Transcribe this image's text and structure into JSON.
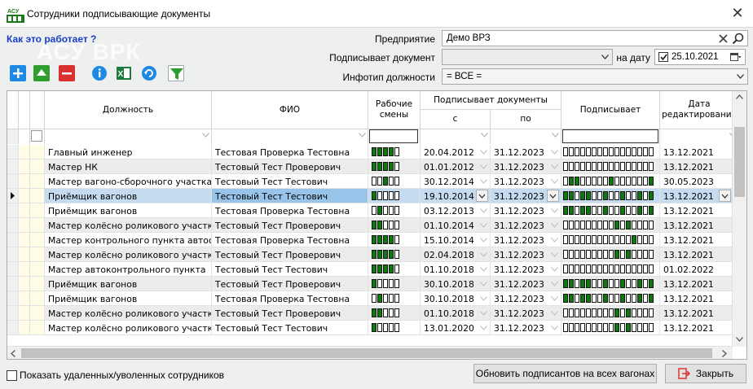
{
  "window": {
    "title": "Сотрудники подписывающие документы",
    "close_glyph": "✕"
  },
  "watermark": "АСУ ВРК",
  "help_link": "Как это работает ?",
  "toolbar": {
    "buttons": [
      "add-icon",
      "move-up-icon",
      "delete-icon",
      "info-icon",
      "excel-export-icon",
      "refresh-icon",
      "filter-icon"
    ]
  },
  "filters": {
    "enterprise_label": "Предприятие",
    "enterprise_value": "Демо ВРЗ",
    "signs_label": "Подписывает документ",
    "signs_value": "",
    "date_label": "на дату",
    "date_value": "25.10.2021",
    "jobtype_label": "Инфотип должности",
    "jobtype_value": "= ВСЕ ="
  },
  "grid": {
    "headers": {
      "position": "Должность",
      "fio": "ФИО",
      "shifts": "Рабочие смены",
      "signs_docs": "Подписывает документы",
      "from": "с",
      "to": "по",
      "signs": "Подписывает",
      "edit_date": "Дата редактирования"
    },
    "rows": [
      {
        "position": "Главный инженер",
        "fio": "Тестовая Проверка Тестовна",
        "shifts": [
          1,
          1,
          1,
          1,
          0
        ],
        "from": "20.04.2012",
        "to": "31.12.2023",
        "signs": [
          0,
          0,
          0,
          0,
          0,
          0,
          0,
          0,
          0,
          0,
          0,
          0,
          0,
          0,
          0,
          0
        ],
        "edit": "13.12.2021",
        "sel": false
      },
      {
        "position": "Мастер НК",
        "fio": "Тестовый Тест Проверович",
        "shifts": [
          1,
          1,
          1,
          1,
          0
        ],
        "from": "01.01.2012",
        "to": "31.12.2023",
        "signs": [
          0,
          0,
          0,
          0,
          0,
          0,
          0,
          0,
          0,
          0,
          0,
          0,
          0,
          0,
          0,
          0
        ],
        "edit": "13.12.2021",
        "sel": false
      },
      {
        "position": "Мастер вагоно-сборочного участка",
        "fio": "Тестовый Тест Тестович",
        "shifts": [
          0,
          0,
          1,
          0,
          0
        ],
        "from": "30.12.2014",
        "to": "31.12.2023",
        "signs": [
          0,
          1,
          1,
          0,
          0,
          0,
          0,
          0,
          1,
          0,
          0,
          0,
          0,
          0,
          0,
          1
        ],
        "edit": "30.05.2023",
        "sel": false
      },
      {
        "position": "Приёмщик вагонов",
        "fio": "Тестовый Тест Тестович",
        "shifts": [
          1,
          0,
          0,
          0,
          0
        ],
        "from": "19.10.2014",
        "to": "31.12.2023",
        "signs": [
          1,
          1,
          0,
          1,
          1,
          0,
          0,
          1,
          0,
          0,
          1,
          0,
          0,
          1,
          0,
          1
        ],
        "edit": "13.12.2021",
        "sel": true
      },
      {
        "position": "Приёмщик вагонов",
        "fio": "Тестовая Проверка Тестовна",
        "shifts": [
          0,
          1,
          0,
          0,
          0
        ],
        "from": "03.12.2013",
        "to": "31.12.2023",
        "signs": [
          1,
          1,
          0,
          1,
          1,
          0,
          0,
          1,
          0,
          0,
          1,
          0,
          0,
          1,
          0,
          1
        ],
        "edit": "13.12.2021",
        "sel": false
      },
      {
        "position": "Мастер колёсно роликового участка",
        "fio": "Тестовый Тест Проверович",
        "shifts": [
          1,
          1,
          0,
          0,
          0
        ],
        "from": "01.10.2014",
        "to": "31.12.2023",
        "signs": [
          0,
          0,
          0,
          0,
          0,
          0,
          0,
          0,
          0,
          1,
          0,
          1,
          0,
          0,
          0,
          0
        ],
        "edit": "13.12.2021",
        "sel": false
      },
      {
        "position": "Мастер контрольного пункта автосц...",
        "fio": "Тестовая Проверка Тестовна",
        "shifts": [
          1,
          1,
          1,
          1,
          0
        ],
        "from": "15.10.2014",
        "to": "31.12.2023",
        "signs": [
          0,
          0,
          0,
          0,
          0,
          0,
          0,
          0,
          0,
          0,
          0,
          0,
          1,
          0,
          0,
          0
        ],
        "edit": "13.12.2021",
        "sel": false
      },
      {
        "position": "Мастер колёсно роликового участка",
        "fio": "Тестовый Тест Проверович",
        "shifts": [
          1,
          1,
          1,
          1,
          0
        ],
        "from": "02.04.2018",
        "to": "31.12.2023",
        "signs": [
          0,
          0,
          0,
          0,
          0,
          0,
          0,
          0,
          0,
          1,
          0,
          1,
          0,
          0,
          0,
          0
        ],
        "edit": "13.12.2021",
        "sel": false
      },
      {
        "position": "Мастер автоконтрольного пункта",
        "fio": "Тестовый Тест Тестович",
        "shifts": [
          1,
          1,
          1,
          1,
          0
        ],
        "from": "01.10.2018",
        "to": "31.12.2023",
        "signs": [
          0,
          0,
          0,
          0,
          0,
          0,
          0,
          0,
          0,
          0,
          0,
          0,
          0,
          0,
          0,
          0
        ],
        "edit": "01.02.2022",
        "sel": false
      },
      {
        "position": "Приёмщик вагонов",
        "fio": "Тестовый Тест Проверович",
        "shifts": [
          1,
          0,
          0,
          0,
          0
        ],
        "from": "30.10.2018",
        "to": "31.12.2023",
        "signs": [
          1,
          1,
          0,
          1,
          1,
          0,
          0,
          1,
          0,
          0,
          1,
          0,
          0,
          1,
          0,
          1
        ],
        "edit": "13.12.2021",
        "sel": false
      },
      {
        "position": "Приёмщик вагонов",
        "fio": "Тестовая Проверка Тестовна",
        "shifts": [
          0,
          1,
          0,
          0,
          0
        ],
        "from": "30.10.2018",
        "to": "31.12.2023",
        "signs": [
          1,
          1,
          0,
          1,
          1,
          0,
          0,
          1,
          0,
          0,
          1,
          0,
          0,
          1,
          0,
          1
        ],
        "edit": "13.12.2021",
        "sel": false
      },
      {
        "position": "Мастер колёсно роликового участка",
        "fio": "Тестовый Тест Проверович",
        "shifts": [
          1,
          1,
          0,
          0,
          0
        ],
        "from": "01.10.2018",
        "to": "31.12.2023",
        "signs": [
          0,
          0,
          0,
          0,
          0,
          0,
          0,
          0,
          0,
          1,
          0,
          1,
          0,
          0,
          0,
          0
        ],
        "edit": "13.12.2021",
        "sel": false
      },
      {
        "position": "Мастер колёсно роликового участка",
        "fio": "Тестовый Тест Тестович",
        "shifts": [
          1,
          0,
          0,
          0,
          0
        ],
        "from": "13.01.2020",
        "to": "31.12.2023",
        "signs": [
          0,
          0,
          0,
          0,
          0,
          0,
          0,
          0,
          0,
          1,
          0,
          1,
          0,
          0,
          0,
          0
        ],
        "edit": "13.12.2021",
        "sel": false
      }
    ]
  },
  "footer": {
    "show_deleted": "Показать удаленных/уволенных сотрудников",
    "update_button": "Обновить подписантов на всех вагонах",
    "close_button": "Закрыть"
  },
  "colors": {
    "accent": "#1a3ec8",
    "green": "#0a7a0a",
    "selected": "#c5dcf0",
    "selected_cell": "#99c4ea"
  }
}
